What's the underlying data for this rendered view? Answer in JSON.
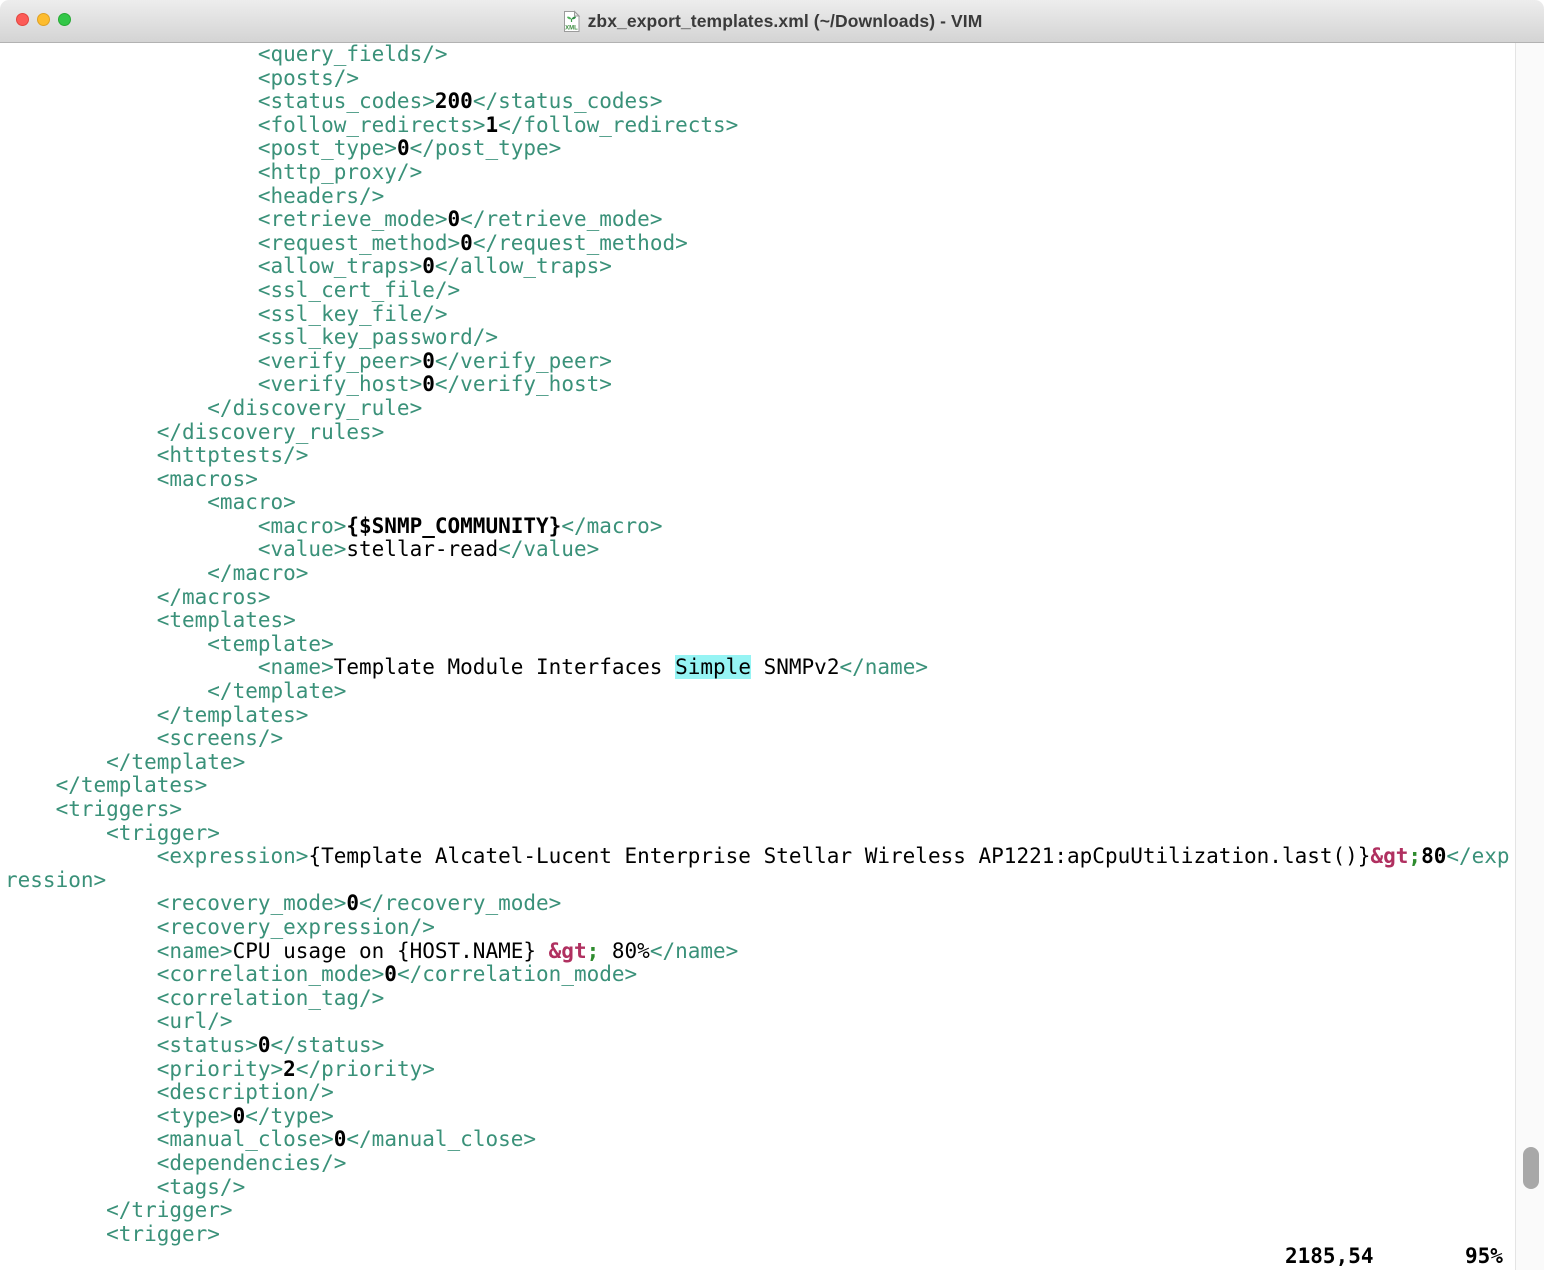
{
  "window": {
    "title": "zbx_export_templates.xml (~/Downloads) - VIM",
    "icon": "xml-document-icon",
    "traffic_lights": [
      "close",
      "minimize",
      "zoom"
    ]
  },
  "colors": {
    "tag": "#3a9179",
    "plain_text": "#000000",
    "bold_value": "#000000",
    "entity": "#b03060",
    "entity_semicolon": "#2e8b2e",
    "search_highlight_bg": "#96f4f4",
    "titlebar_top": "#ededed",
    "titlebar_bottom": "#d4d4d4",
    "scrollbar_thumb": "#a8a8a8",
    "background": "#ffffff"
  },
  "ruler": {
    "position": "2185,54",
    "percent": "95%"
  },
  "editor": {
    "lines": [
      [
        [
          "t",
          "                    <query_fields/>"
        ]
      ],
      [
        [
          "t",
          "                    <posts/>"
        ]
      ],
      [
        [
          "t",
          "                    <status_codes>"
        ],
        [
          "b",
          "200"
        ],
        [
          "t",
          "</status_codes>"
        ]
      ],
      [
        [
          "t",
          "                    <follow_redirects>"
        ],
        [
          "b",
          "1"
        ],
        [
          "t",
          "</follow_redirects>"
        ]
      ],
      [
        [
          "t",
          "                    <post_type>"
        ],
        [
          "b",
          "0"
        ],
        [
          "t",
          "</post_type>"
        ]
      ],
      [
        [
          "t",
          "                    <http_proxy/>"
        ]
      ],
      [
        [
          "t",
          "                    <headers/>"
        ]
      ],
      [
        [
          "t",
          "                    <retrieve_mode>"
        ],
        [
          "b",
          "0"
        ],
        [
          "t",
          "</retrieve_mode>"
        ]
      ],
      [
        [
          "t",
          "                    <request_method>"
        ],
        [
          "b",
          "0"
        ],
        [
          "t",
          "</request_method>"
        ]
      ],
      [
        [
          "t",
          "                    <allow_traps>"
        ],
        [
          "b",
          "0"
        ],
        [
          "t",
          "</allow_traps>"
        ]
      ],
      [
        [
          "t",
          "                    <ssl_cert_file/>"
        ]
      ],
      [
        [
          "t",
          "                    <ssl_key_file/>"
        ]
      ],
      [
        [
          "t",
          "                    <ssl_key_password/>"
        ]
      ],
      [
        [
          "t",
          "                    <verify_peer>"
        ],
        [
          "b",
          "0"
        ],
        [
          "t",
          "</verify_peer>"
        ]
      ],
      [
        [
          "t",
          "                    <verify_host>"
        ],
        [
          "b",
          "0"
        ],
        [
          "t",
          "</verify_host>"
        ]
      ],
      [
        [
          "t",
          "                </discovery_rule>"
        ]
      ],
      [
        [
          "t",
          "            </discovery_rules>"
        ]
      ],
      [
        [
          "t",
          "            <httptests/>"
        ]
      ],
      [
        [
          "t",
          "            <macros>"
        ]
      ],
      [
        [
          "t",
          "                <macro>"
        ]
      ],
      [
        [
          "t",
          "                    <macro>"
        ],
        [
          "b",
          "{$SNMP_COMMUNITY}"
        ],
        [
          "t",
          "</macro>"
        ]
      ],
      [
        [
          "t",
          "                    <value>"
        ],
        [
          "p",
          "stellar-read"
        ],
        [
          "t",
          "</value>"
        ]
      ],
      [
        [
          "t",
          "                </macro>"
        ]
      ],
      [
        [
          "t",
          "            </macros>"
        ]
      ],
      [
        [
          "t",
          "            <templates>"
        ]
      ],
      [
        [
          "t",
          "                <template>"
        ]
      ],
      [
        [
          "t",
          "                    <name>"
        ],
        [
          "p",
          "Template Module Interfaces "
        ],
        [
          "hl",
          "Simple"
        ],
        [
          "p",
          " SNMPv2"
        ],
        [
          "t",
          "</name>"
        ]
      ],
      [
        [
          "t",
          "                </template>"
        ]
      ],
      [
        [
          "t",
          "            </templates>"
        ]
      ],
      [
        [
          "t",
          "            <screens/>"
        ]
      ],
      [
        [
          "t",
          "        </template>"
        ]
      ],
      [
        [
          "t",
          "    </templates>"
        ]
      ],
      [
        [
          "t",
          "    <triggers>"
        ]
      ],
      [
        [
          "t",
          "        <trigger>"
        ]
      ],
      [
        [
          "t",
          "            <expression>"
        ],
        [
          "p",
          "{Template Alcatel-Lucent Enterprise Stellar Wireless AP1221:apCpuUtilization.last()}"
        ],
        [
          "e",
          "&gt"
        ],
        [
          "s",
          ";"
        ],
        [
          "b",
          "80"
        ],
        [
          "t",
          "</exp"
        ]
      ],
      [
        [
          "t",
          "ression>"
        ]
      ],
      [
        [
          "t",
          "            <recovery_mode>"
        ],
        [
          "b",
          "0"
        ],
        [
          "t",
          "</recovery_mode>"
        ]
      ],
      [
        [
          "t",
          "            <recovery_expression/>"
        ]
      ],
      [
        [
          "t",
          "            <name>"
        ],
        [
          "p",
          "CPU usage on {HOST.NAME} "
        ],
        [
          "e",
          "&gt"
        ],
        [
          "s",
          ";"
        ],
        [
          "p",
          " 80%"
        ],
        [
          "t",
          "</name>"
        ]
      ],
      [
        [
          "t",
          "            <correlation_mode>"
        ],
        [
          "b",
          "0"
        ],
        [
          "t",
          "</correlation_mode>"
        ]
      ],
      [
        [
          "t",
          "            <correlation_tag/>"
        ]
      ],
      [
        [
          "t",
          "            <url/>"
        ]
      ],
      [
        [
          "t",
          "            <status>"
        ],
        [
          "b",
          "0"
        ],
        [
          "t",
          "</status>"
        ]
      ],
      [
        [
          "t",
          "            <priority>"
        ],
        [
          "b",
          "2"
        ],
        [
          "t",
          "</priority>"
        ]
      ],
      [
        [
          "t",
          "            <description/>"
        ]
      ],
      [
        [
          "t",
          "            <type>"
        ],
        [
          "b",
          "0"
        ],
        [
          "t",
          "</type>"
        ]
      ],
      [
        [
          "t",
          "            <manual_close>"
        ],
        [
          "b",
          "0"
        ],
        [
          "t",
          "</manual_close>"
        ]
      ],
      [
        [
          "t",
          "            <dependencies/>"
        ]
      ],
      [
        [
          "t",
          "            <tags/>"
        ]
      ],
      [
        [
          "t",
          "        </trigger>"
        ]
      ],
      [
        [
          "t",
          "        <trigger>"
        ]
      ]
    ]
  }
}
